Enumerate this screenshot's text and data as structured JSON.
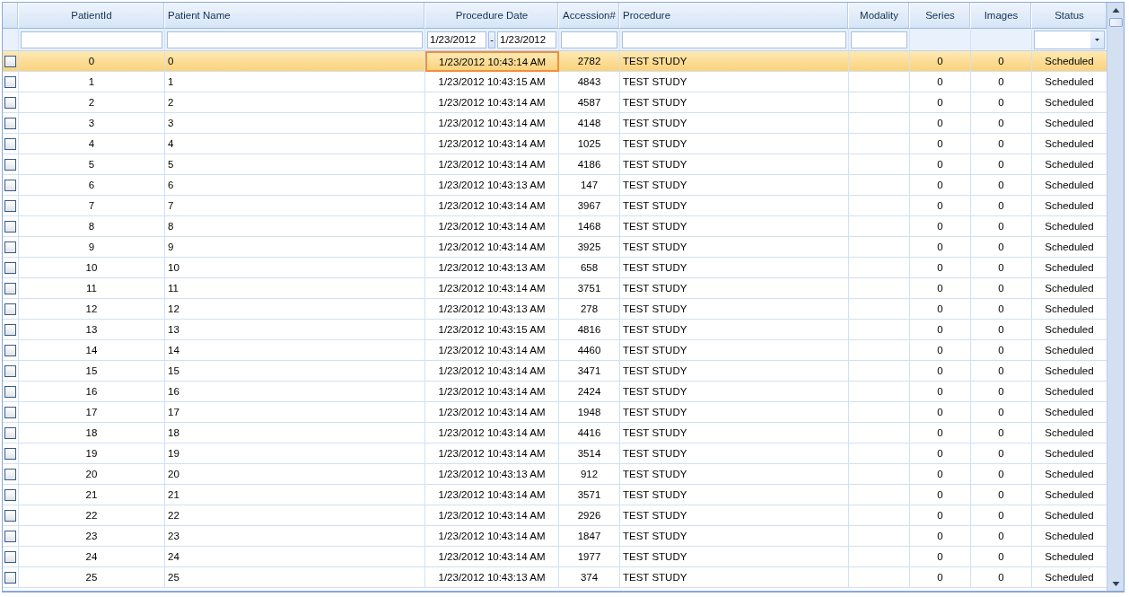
{
  "columns": [
    {
      "focused": false
    },
    {
      "label": "PatientId",
      "focused": false
    },
    {
      "label": "Patient Name",
      "focused": false
    },
    {
      "label": "Procedure Date",
      "focused": true
    },
    {
      "label": "Accession#",
      "focused": false
    },
    {
      "label": "Procedure",
      "focused": false
    },
    {
      "label": "Modality",
      "focused": false
    },
    {
      "label": "Series",
      "focused": false
    },
    {
      "label": "Images",
      "focused": false
    },
    {
      "label": "Status",
      "focused": false
    }
  ],
  "filters": [
    {
      "kind": "none"
    },
    {
      "kind": "text"
    },
    {
      "kind": "text"
    },
    {
      "kind": "date_range",
      "from": "1/23/2012",
      "separator": "-",
      "to": "1/23/2012"
    },
    {
      "kind": "text"
    },
    {
      "kind": "text"
    },
    {
      "kind": "text"
    },
    {
      "kind": "none"
    },
    {
      "kind": "none"
    },
    {
      "kind": "dropdown"
    }
  ],
  "rows": [
    {
      "selected": true,
      "checked": false,
      "cells": [
        "0",
        "0",
        "1/23/2012 10:43:14 AM",
        "2782",
        "TEST STUDY",
        null,
        "0",
        "0",
        "Scheduled"
      ]
    },
    {
      "selected": false,
      "checked": false,
      "cells": [
        "1",
        "1",
        "1/23/2012 10:43:15 AM",
        "4843",
        "TEST STUDY",
        null,
        "0",
        "0",
        "Scheduled"
      ]
    },
    {
      "selected": false,
      "checked": false,
      "cells": [
        "2",
        "2",
        "1/23/2012 10:43:14 AM",
        "4587",
        "TEST STUDY",
        null,
        "0",
        "0",
        "Scheduled"
      ]
    },
    {
      "selected": false,
      "checked": false,
      "cells": [
        "3",
        "3",
        "1/23/2012 10:43:14 AM",
        "4148",
        "TEST STUDY",
        null,
        "0",
        "0",
        "Scheduled"
      ]
    },
    {
      "selected": false,
      "checked": false,
      "cells": [
        "4",
        "4",
        "1/23/2012 10:43:14 AM",
        "1025",
        "TEST STUDY",
        null,
        "0",
        "0",
        "Scheduled"
      ]
    },
    {
      "selected": false,
      "checked": false,
      "cells": [
        "5",
        "5",
        "1/23/2012 10:43:14 AM",
        "4186",
        "TEST STUDY",
        null,
        "0",
        "0",
        "Scheduled"
      ]
    },
    {
      "selected": false,
      "checked": false,
      "cells": [
        "6",
        "6",
        "1/23/2012 10:43:13 AM",
        "147",
        "TEST STUDY",
        null,
        "0",
        "0",
        "Scheduled"
      ]
    },
    {
      "selected": false,
      "checked": false,
      "cells": [
        "7",
        "7",
        "1/23/2012 10:43:14 AM",
        "3967",
        "TEST STUDY",
        null,
        "0",
        "0",
        "Scheduled"
      ]
    },
    {
      "selected": false,
      "checked": false,
      "cells": [
        "8",
        "8",
        "1/23/2012 10:43:14 AM",
        "1468",
        "TEST STUDY",
        null,
        "0",
        "0",
        "Scheduled"
      ]
    },
    {
      "selected": false,
      "checked": false,
      "cells": [
        "9",
        "9",
        "1/23/2012 10:43:14 AM",
        "3925",
        "TEST STUDY",
        null,
        "0",
        "0",
        "Scheduled"
      ]
    },
    {
      "selected": false,
      "checked": false,
      "cells": [
        "10",
        "10",
        "1/23/2012 10:43:13 AM",
        "658",
        "TEST STUDY",
        null,
        "0",
        "0",
        "Scheduled"
      ]
    },
    {
      "selected": false,
      "checked": false,
      "cells": [
        "11",
        "11",
        "1/23/2012 10:43:14 AM",
        "3751",
        "TEST STUDY",
        null,
        "0",
        "0",
        "Scheduled"
      ]
    },
    {
      "selected": false,
      "checked": false,
      "cells": [
        "12",
        "12",
        "1/23/2012 10:43:13 AM",
        "278",
        "TEST STUDY",
        null,
        "0",
        "0",
        "Scheduled"
      ]
    },
    {
      "selected": false,
      "checked": false,
      "cells": [
        "13",
        "13",
        "1/23/2012 10:43:15 AM",
        "4816",
        "TEST STUDY",
        null,
        "0",
        "0",
        "Scheduled"
      ]
    },
    {
      "selected": false,
      "checked": false,
      "cells": [
        "14",
        "14",
        "1/23/2012 10:43:14 AM",
        "4460",
        "TEST STUDY",
        null,
        "0",
        "0",
        "Scheduled"
      ]
    },
    {
      "selected": false,
      "checked": false,
      "cells": [
        "15",
        "15",
        "1/23/2012 10:43:14 AM",
        "3471",
        "TEST STUDY",
        null,
        "0",
        "0",
        "Scheduled"
      ]
    },
    {
      "selected": false,
      "checked": false,
      "cells": [
        "16",
        "16",
        "1/23/2012 10:43:14 AM",
        "2424",
        "TEST STUDY",
        null,
        "0",
        "0",
        "Scheduled"
      ]
    },
    {
      "selected": false,
      "checked": false,
      "cells": [
        "17",
        "17",
        "1/23/2012 10:43:14 AM",
        "1948",
        "TEST STUDY",
        null,
        "0",
        "0",
        "Scheduled"
      ]
    },
    {
      "selected": false,
      "checked": false,
      "cells": [
        "18",
        "18",
        "1/23/2012 10:43:14 AM",
        "4416",
        "TEST STUDY",
        null,
        "0",
        "0",
        "Scheduled"
      ]
    },
    {
      "selected": false,
      "checked": false,
      "cells": [
        "19",
        "19",
        "1/23/2012 10:43:14 AM",
        "3514",
        "TEST STUDY",
        null,
        "0",
        "0",
        "Scheduled"
      ]
    },
    {
      "selected": false,
      "checked": false,
      "cells": [
        "20",
        "20",
        "1/23/2012 10:43:13 AM",
        "912",
        "TEST STUDY",
        null,
        "0",
        "0",
        "Scheduled"
      ]
    },
    {
      "selected": false,
      "checked": false,
      "cells": [
        "21",
        "21",
        "1/23/2012 10:43:14 AM",
        "3571",
        "TEST STUDY",
        null,
        "0",
        "0",
        "Scheduled"
      ]
    },
    {
      "selected": false,
      "checked": false,
      "cells": [
        "22",
        "22",
        "1/23/2012 10:43:14 AM",
        "2926",
        "TEST STUDY",
        null,
        "0",
        "0",
        "Scheduled"
      ]
    },
    {
      "selected": false,
      "checked": false,
      "cells": [
        "23",
        "23",
        "1/23/2012 10:43:14 AM",
        "1847",
        "TEST STUDY",
        null,
        "0",
        "0",
        "Scheduled"
      ]
    },
    {
      "selected": false,
      "checked": false,
      "cells": [
        "24",
        "24",
        "1/23/2012 10:43:14 AM",
        "1977",
        "TEST STUDY",
        null,
        "0",
        "0",
        "Scheduled"
      ]
    },
    {
      "selected": false,
      "checked": false,
      "cells": [
        "25",
        "25",
        "1/23/2012 10:43:13 AM",
        "374",
        "TEST STUDY",
        null,
        "0",
        "0",
        "Scheduled"
      ]
    }
  ]
}
